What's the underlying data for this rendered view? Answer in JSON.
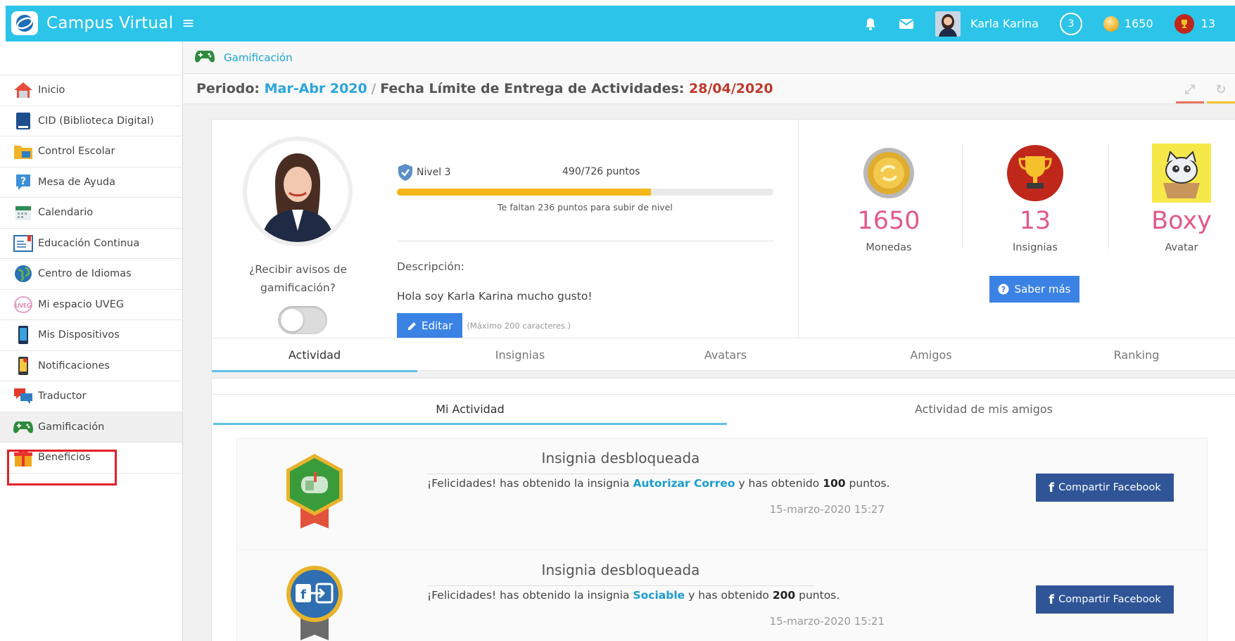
{
  "topbar": {
    "title": "Campus Virtual",
    "user_name": "Karla Karina",
    "level_badge": "3",
    "coins": "1650",
    "trophies": "13",
    "color": "#2dc4ea"
  },
  "sidebar": {
    "items": [
      {
        "label": "Inicio",
        "icon": "home-icon"
      },
      {
        "label": "CID (Biblioteca Digital)",
        "icon": "book-icon"
      },
      {
        "label": "Control Escolar",
        "icon": "folder-icon"
      },
      {
        "label": "Mesa de Ayuda",
        "icon": "help-icon"
      },
      {
        "label": "Calendario",
        "icon": "calendar-icon"
      },
      {
        "label": "Educación Continua",
        "icon": "document-icon"
      },
      {
        "label": "Centro de Idiomas",
        "icon": "globe-icon"
      },
      {
        "label": "Mi espacio UVEG",
        "icon": "space-icon"
      },
      {
        "label": "Mis Dispositivos",
        "icon": "phone-icon"
      },
      {
        "label": "Notificaciones",
        "icon": "notification-phone-icon"
      },
      {
        "label": "Traductor",
        "icon": "chat-icon"
      },
      {
        "label": "Gamificación",
        "icon": "gamepad-icon"
      },
      {
        "label": "Beneficios",
        "icon": "gift-icon"
      }
    ],
    "active_index": 11
  },
  "breadcrumb": {
    "label": "Gamificación"
  },
  "period": {
    "label": "Periodo:",
    "value": "Mar-Abr 2020",
    "separator": "/",
    "deadline_label": "Fecha Límite de Entrega de Actividades:",
    "deadline_value": "28/04/2020"
  },
  "profile": {
    "notify_label": "¿Recibir avisos de gamificación?",
    "notify_enabled": false
  },
  "level": {
    "name": "Nivel 3",
    "points": "490/726 puntos",
    "progress": 0.675,
    "remaining": "Te faltan 236 puntos para subir de nivel",
    "desc_label": "Descripción:",
    "desc_text": "Hola soy Karla Karina mucho gusto!",
    "edit_label": "Editar",
    "edit_hint": "(Máximo 200 caracteres.)"
  },
  "stats": {
    "coins_value": "1650",
    "coins_label": "Monedas",
    "badges_value": "13",
    "badges_label": "Insignias",
    "avatar_value": "Boxy",
    "avatar_label": "Avatar",
    "more_label": "Saber más"
  },
  "tabs": [
    "Actividad",
    "Insignias",
    "Avatars",
    "Amigos",
    "Ranking"
  ],
  "subtabs": [
    "Mi Actividad",
    "Actividad de mis amigos"
  ],
  "feed": [
    {
      "title": "Insignia desbloqueada",
      "pre": "¡Felicidades! has obtenido la insignia ",
      "badge": "Autorizar Correo",
      "mid": " y has obtenido ",
      "points": "100",
      "post": " puntos.",
      "date": "15-marzo-2020 15:27",
      "share": "Compartir Facebook",
      "icon": "mailbox-badge-icon"
    },
    {
      "title": "Insignia desbloqueada",
      "pre": "¡Felicidades! has obtenido la insignia ",
      "badge": "Sociable",
      "mid": " y has obtenido ",
      "points": "200",
      "post": " puntos.",
      "date": "15-marzo-2020 15:21",
      "share": "Compartir Facebook",
      "icon": "social-badge-icon"
    }
  ]
}
